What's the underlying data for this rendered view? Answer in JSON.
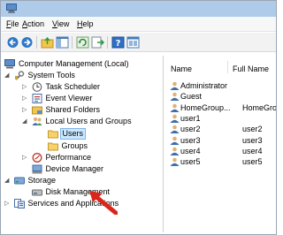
{
  "menu": {
    "file_first": "F",
    "file_rest": "ile",
    "action_first": "A",
    "action_rest": "ction",
    "view_first": "V",
    "view_rest": "iew",
    "help_first": "H",
    "help_rest": "elp"
  },
  "toolbar": {
    "icons": [
      "back-arrow-icon",
      "forward-arrow-icon",
      "up-folder-icon",
      "show-hide-console-tree-icon",
      "refresh-icon",
      "export-list-icon",
      "help-icon",
      "properties-icon"
    ]
  },
  "tree": {
    "root": "Computer Management (Local)",
    "system_tools": "System Tools",
    "task_scheduler": "Task Scheduler",
    "event_viewer": "Event Viewer",
    "shared_folders": "Shared Folders",
    "local_users_groups": "Local Users and Groups",
    "users": "Users",
    "groups": "Groups",
    "performance": "Performance",
    "device_manager": "Device Manager",
    "storage": "Storage",
    "disk_management": "Disk Management",
    "services_apps": "Services and Applications"
  },
  "list": {
    "col_name": "Name",
    "col_fullname": "Full Name",
    "rows": [
      {
        "name": "Administrator",
        "full": ""
      },
      {
        "name": "Guest",
        "full": ""
      },
      {
        "name": "HomeGroup...",
        "full": "HomeGrou"
      },
      {
        "name": "user1",
        "full": ""
      },
      {
        "name": "user2",
        "full": "user2"
      },
      {
        "name": "user3",
        "full": "user3"
      },
      {
        "name": "user4",
        "full": "user4"
      },
      {
        "name": "user5",
        "full": "user5"
      }
    ]
  },
  "colors": {
    "titlebar": "#aecbea",
    "selection": "#cce8ff",
    "arrow": "#d9261c"
  }
}
